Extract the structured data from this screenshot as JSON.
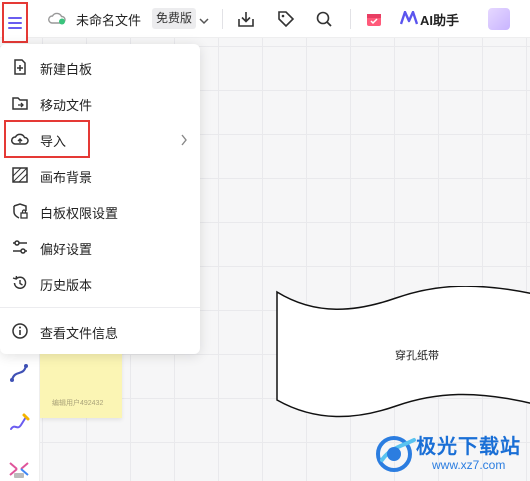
{
  "toolbar": {
    "doc_title": "未命名文件",
    "plan_badge": "免费版",
    "ai_label": "AI助手",
    "icons": [
      "menu-icon",
      "cloud-saved-icon",
      "chevron-down-icon",
      "download-icon",
      "tag-icon",
      "search-icon",
      "calendar-icon",
      "ai-logo-icon",
      "image-icon"
    ]
  },
  "menu": {
    "items": [
      {
        "label": "新建白板",
        "icon": "new-board-icon"
      },
      {
        "label": "移动文件",
        "icon": "move-folder-icon"
      },
      {
        "label": "导入",
        "icon": "cloud-upload-icon",
        "has_submenu": true
      },
      {
        "label": "画布背景",
        "icon": "canvas-background-icon"
      },
      {
        "label": "白板权限设置",
        "icon": "permission-lock-icon"
      },
      {
        "label": "偏好设置",
        "icon": "sliders-icon"
      },
      {
        "label": "历史版本",
        "icon": "history-icon"
      },
      {
        "label": "查看文件信息",
        "icon": "info-icon"
      }
    ]
  },
  "canvas": {
    "shape_label": "穿孔纸带",
    "sticky_user": "编辑用户492432"
  },
  "watermark": {
    "title": "极光下载站",
    "url": "www.xz7.com"
  },
  "colors": {
    "accent": "#6a5cf0",
    "highlight": "#e53935",
    "sticky": "#fbf5b4",
    "watermark": "#1a6fd6"
  }
}
